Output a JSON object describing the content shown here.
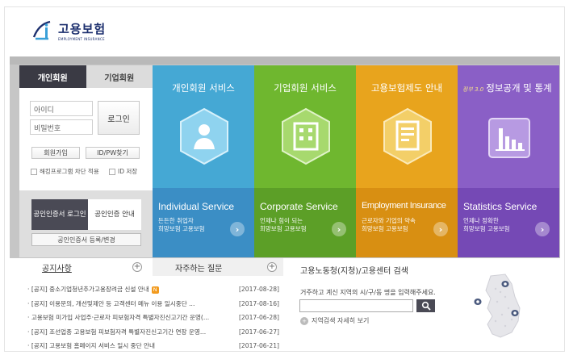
{
  "header": {
    "logo_name": "고용보험",
    "logo_sub": "EMPLOYMENT INSURANCE"
  },
  "login": {
    "tabs": [
      "개인회원",
      "기업회원"
    ],
    "id_placeholder": "아이디",
    "pw_placeholder": "비밀번호",
    "login_label": "로그인",
    "signup_label": "회원가입",
    "find_label": "ID/PW찾기",
    "hacking_label": "해킹프로그램 차단 적용",
    "save_id_label": "ID 저장",
    "cert_login_label": "공인인증서 로그인",
    "cert_guide_label": "공인인증 안내",
    "cert_register_label": "공인인증서 등록/변경"
  },
  "tiles": [
    {
      "title": "개인회원 서비스",
      "en": "Individual Service",
      "desc1": "든든한 취업자",
      "desc2": "희망보험 고용보험",
      "color": "#45a8d4",
      "bottom": "#3b8ec5",
      "icon": "person-icon"
    },
    {
      "title": "기업회원 서비스",
      "en": "Corporate Service",
      "desc1": "언제나 힘이 되는",
      "desc2": "희망보험 고용보험",
      "color": "#6fb72f",
      "bottom": "#5c9f27",
      "icon": "building-icon"
    },
    {
      "title": "고용보험제도 안내",
      "en": "Employment Insurance",
      "desc1": "근로자와 기업의 약속",
      "desc2": "희망보험 고용보험",
      "color": "#e8a41d",
      "bottom": "#d88f12",
      "icon": "document-icon"
    },
    {
      "title": "정보공개 및 통계",
      "badge": "정부 3.0",
      "en": "Statistics Service",
      "desc1": "언제나 정확한",
      "desc2": "희망보험 고용보험",
      "color": "#8a5fc6",
      "bottom": "#7549b5",
      "icon": "bar-chart-icon"
    }
  ],
  "notice": {
    "tab1": "공지사항",
    "tab2": "자주하는 질문",
    "items": [
      {
        "text": "[공지] 중소기업청년추가고용장려금 신설 안내",
        "date": "[2017-08-28]",
        "new": "N"
      },
      {
        "text": "[공지] 이용문의, 개선및제안 등 고객센터 메뉴 이용 일시중단 ...",
        "date": "[2017-08-16]"
      },
      {
        "text": "고용보험 미가입 사업주·근로자 피보험자격 특별자진신고기간 운영(...",
        "date": "[2017-06-28]"
      },
      {
        "text": "[공지] 조선업종 고용보험 피보험자격 특별자진신고기간 연장 운영...",
        "date": "[2017-06-27]"
      },
      {
        "text": "[공지] 고용보험 홈페이지 서비스 일시 중단 안내",
        "date": "[2017-06-21]"
      }
    ]
  },
  "search": {
    "title": "고용노동청(지청)/고용센터 검색",
    "desc": "거주하고 계신 지역의 시/구/동 명을 입력해주세요.",
    "detail": "지역검색 자세히 보기"
  }
}
